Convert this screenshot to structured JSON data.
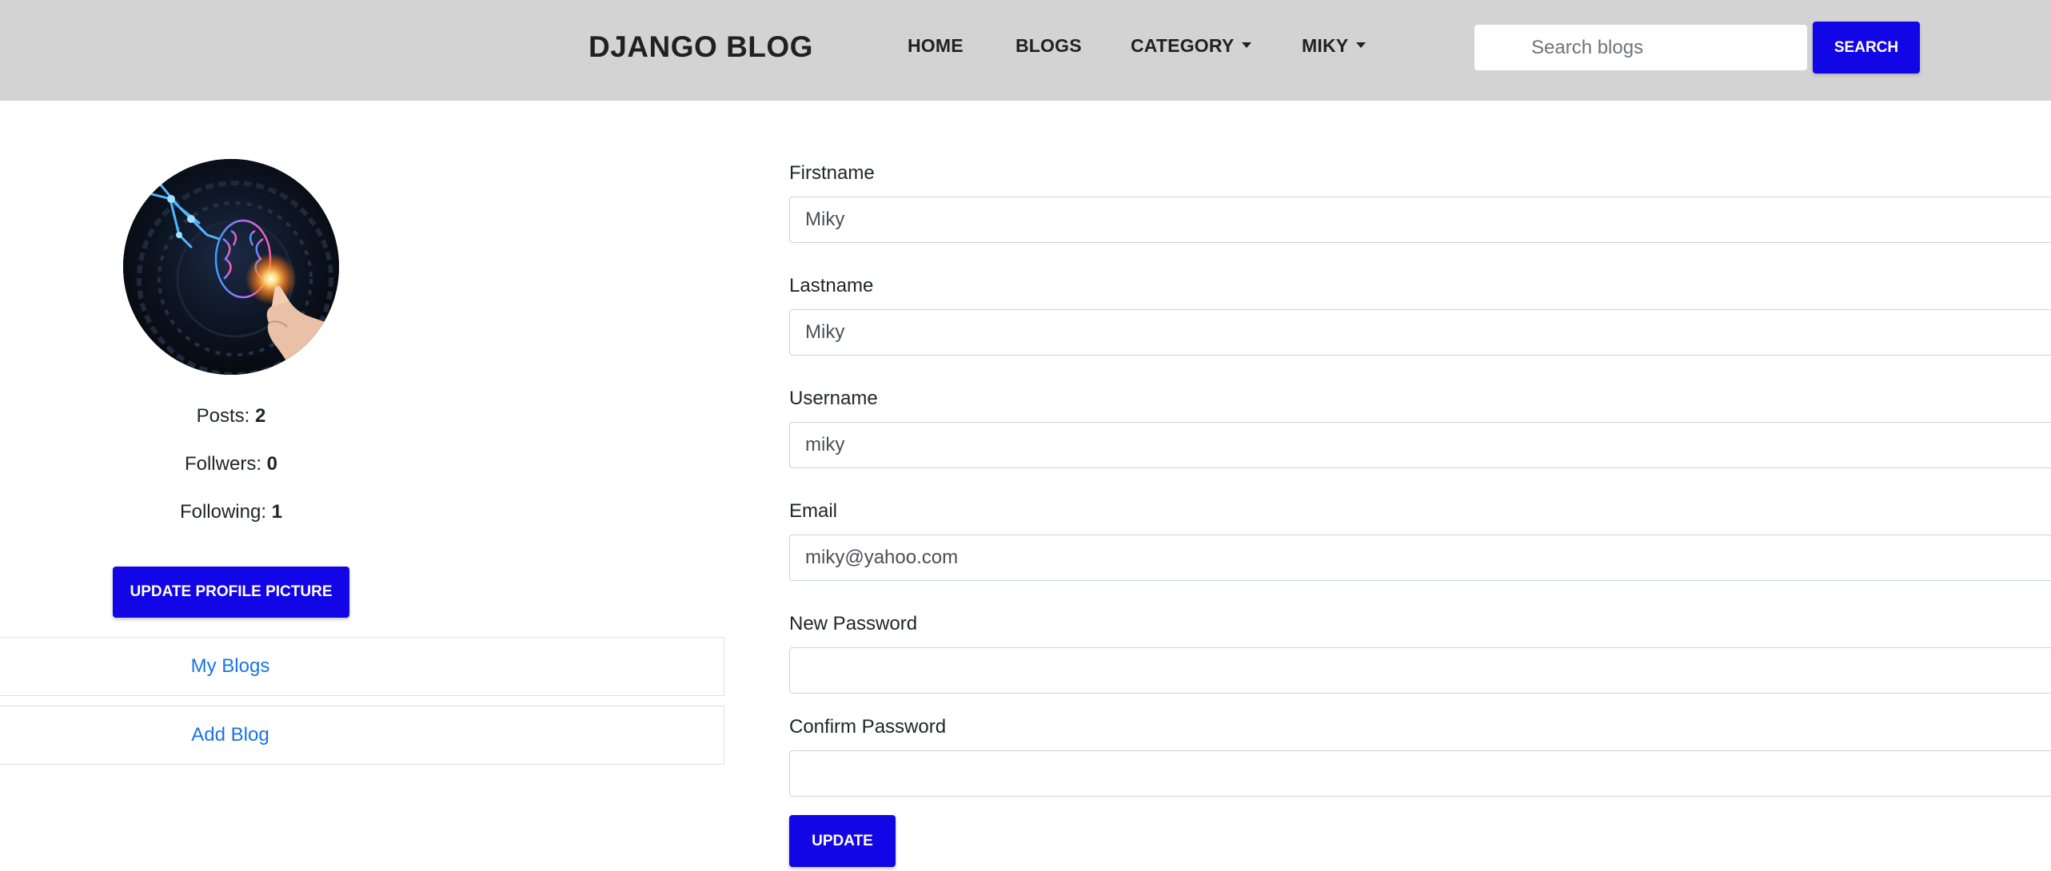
{
  "colors": {
    "navbar_bg": "#d3d3d3",
    "primary_button": "#1205e6",
    "link": "#1a73e8"
  },
  "navbar": {
    "brand": "DJANGO BLOG",
    "links": {
      "home": "HOME",
      "blogs": "BLOGS",
      "category": "CATEGORY",
      "user": "MIKY"
    },
    "search": {
      "placeholder": "Search blogs",
      "button_label": "SEARCH"
    }
  },
  "profile": {
    "avatar_icon": "ai-brain-hand-icon",
    "stats": {
      "posts_label": "Posts:",
      "posts_value": "2",
      "followers_label": "Follwers:",
      "followers_value": "0",
      "following_label": "Following:",
      "following_value": "1"
    },
    "update_picture_label": "UPDATE PROFILE PICTURE",
    "links": {
      "my_blogs": "My Blogs",
      "add_blog": "Add Blog"
    }
  },
  "form": {
    "firstname": {
      "label": "Firstname",
      "value": "Miky"
    },
    "lastname": {
      "label": "Lastname",
      "value": "Miky"
    },
    "username": {
      "label": "Username",
      "value": "miky"
    },
    "email": {
      "label": "Email",
      "value": "miky@yahoo.com"
    },
    "new_password": {
      "label": "New Password",
      "value": ""
    },
    "confirm_password": {
      "label": "Confirm Password",
      "value": ""
    },
    "submit_label": "UPDATE"
  }
}
